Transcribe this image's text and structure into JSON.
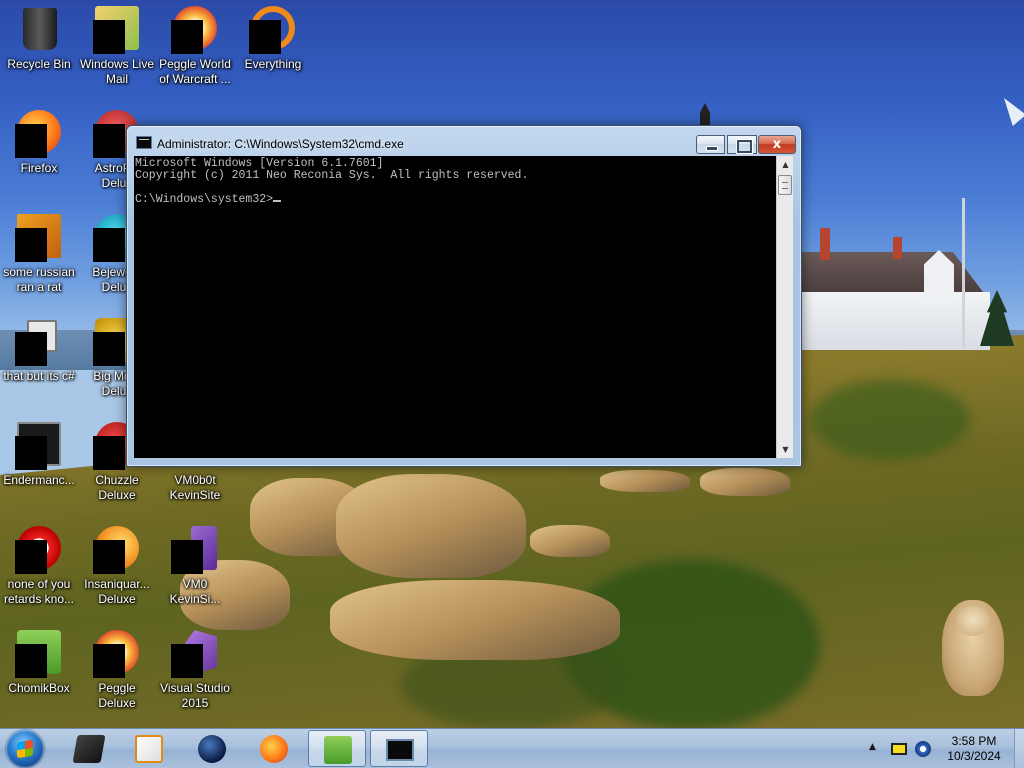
{
  "desktop": {
    "icons": [
      {
        "label": "Recycle Bin",
        "icon": "recycle-bin-icon"
      },
      {
        "label": "Windows Live Mail",
        "icon": "mail-icon"
      },
      {
        "label": "Peggle World of Warcraft ...",
        "icon": "peggle-icon"
      },
      {
        "label": "Everything",
        "icon": "search-icon"
      },
      {
        "label": "Firefox",
        "icon": "firefox-icon"
      },
      {
        "label": "AstroP... Delux",
        "icon": "game-icon"
      },
      {
        "label": "some russian ran a rat",
        "icon": "app-icon"
      },
      {
        "label": "Bejewe... Delux",
        "icon": "bejeweled-icon"
      },
      {
        "label": "that but its c#",
        "icon": "copy-icon"
      },
      {
        "label": "Big Mo... Delux",
        "icon": "game-icon"
      },
      {
        "label": "Endermanc...",
        "icon": "app-icon"
      },
      {
        "label": "Chuzzle Deluxe",
        "icon": "chuzzle-icon"
      },
      {
        "label": "VM0b0t KevinSite",
        "icon": "vm-icon"
      },
      {
        "label": "none of you retards kno...",
        "icon": "opera-icon"
      },
      {
        "label": "Insaniquar... Deluxe",
        "icon": "insaniquarium-icon"
      },
      {
        "label": "VM0 KevinSi...",
        "icon": "visual-studio-icon"
      },
      {
        "label": "ChomikBox",
        "icon": "chomikbox-icon"
      },
      {
        "label": "Peggle Deluxe",
        "icon": "peggle-icon"
      },
      {
        "label": "Visual Studio 2015",
        "icon": "visual-studio-icon"
      }
    ]
  },
  "cmd_window": {
    "title": "Administrator: C:\\Windows\\System32\\cmd.exe",
    "lines": [
      "Microsoft Windows [Version 6.1.7601]",
      "Copyright (c) 2011 Neo Reconia Sys.  All rights reserved.",
      "",
      "C:\\Windows\\system32>"
    ],
    "close_glyph": "x",
    "scroll_up_glyph": "▲",
    "scroll_down_glyph": "▼"
  },
  "taskbar": {
    "tray_arrow": "▲",
    "time": "3:58 PM",
    "date": "10/3/2024"
  }
}
